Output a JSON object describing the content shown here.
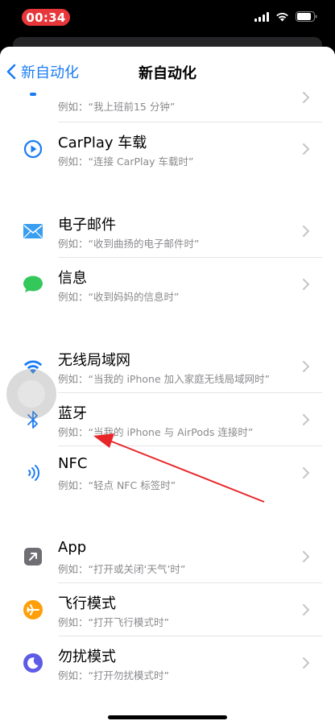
{
  "status": {
    "time": "00:34"
  },
  "nav": {
    "back_label": "新自动化",
    "title": "新自动化"
  },
  "rows": {
    "partial": {
      "subtitle": "例如：“我上班前15 分钟”"
    },
    "carplay": {
      "title": "CarPlay 车载",
      "subtitle": "例如：“连接 CarPlay 车载时”",
      "icon": "carplay-icon"
    },
    "email": {
      "title": "电子邮件",
      "subtitle": "例如：“收到曲扬的电子邮件时”",
      "icon": "mail-icon"
    },
    "message": {
      "title": "信息",
      "subtitle": "例如：“收到妈妈的信息时”",
      "icon": "message-icon"
    },
    "wifi": {
      "title": "无线局域网",
      "subtitle": "例如：“当我的 iPhone 加入家庭无线局域网时”",
      "icon": "wifi-icon"
    },
    "bluetooth": {
      "title": "蓝牙",
      "subtitle": "例如：“当我的 iPhone 与 AirPods 连接时”",
      "icon": "bluetooth-icon"
    },
    "nfc": {
      "title": "NFC",
      "subtitle": "例如：“轻点 NFC 标签时”",
      "icon": "nfc-icon"
    },
    "app": {
      "title": "App",
      "subtitle": "例如：“打开或关闭‘天气’时”",
      "icon": "app-icon"
    },
    "airplane": {
      "title": "飞行模式",
      "subtitle": "例如：“打开飞行模式时”",
      "icon": "airplane-icon"
    },
    "dnd": {
      "title": "勿扰模式",
      "subtitle": "例如：“打开勿扰模式时”",
      "icon": "moon-icon"
    }
  },
  "colors": {
    "accent": "#1a7cf5",
    "time_pill": "#e8373a",
    "mail": "#3a9ef0",
    "message": "#34c759",
    "airplane": "#ff9f0a",
    "dnd": "#5e5ce6",
    "annotation": "#e8262a"
  }
}
